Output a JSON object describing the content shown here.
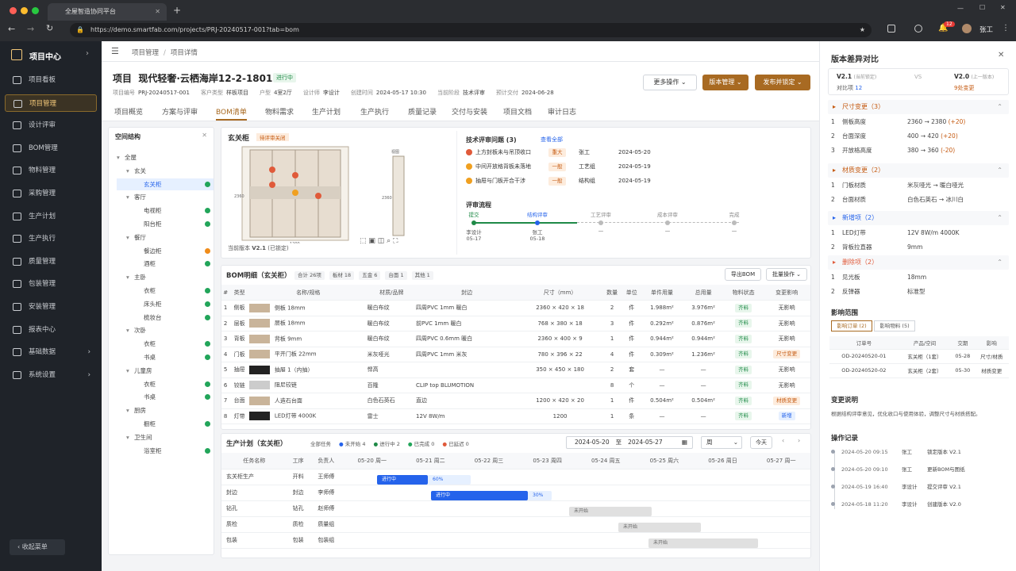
{
  "browser": {
    "tab_title": "全屋智造协同平台",
    "url": "https://demo.smartfab.com/projects/PRJ-20240517-001?tab=bom",
    "user": "张工",
    "notif": "12"
  },
  "sidebar": {
    "title": "项目中心",
    "items": [
      "项目看板",
      "项目管理",
      "设计评审",
      "BOM管理",
      "物料管理",
      "采购管理",
      "生产计划",
      "生产执行",
      "质量管理",
      "包装管理",
      "安装管理",
      "报表中心",
      "基础数据",
      "系统设置"
    ],
    "collapse": "收起菜单"
  },
  "breadcrumb": [
    "项目管理",
    "项目详情"
  ],
  "project": {
    "prefix": "项目",
    "name": "现代轻奢·云栖海岸12-2-1801",
    "status": "进行中",
    "meta": [
      "项目编号",
      "PRJ-20240517-001",
      "客户类型",
      "样板项目",
      "户型",
      "4室2厅",
      "设计师",
      "李设计",
      "创建时间",
      "2024-05-17 10:30",
      "当前阶段",
      "技术评审",
      "预计交付",
      "2024-06-28"
    ]
  },
  "actions": {
    "more": "更多操作",
    "version": "版本管理",
    "publish": "发布并锁定"
  },
  "tabs": [
    "项目概览",
    "方案与评审",
    "BOM清单",
    "物料需求",
    "生产计划",
    "生产执行",
    "质量记录",
    "交付与安装",
    "项目文档",
    "审计日志"
  ],
  "space": {
    "title": "空间结构",
    "tree": [
      "全屋",
      "玄关",
      "玄关柜",
      "客厅",
      "电视柜",
      "阳台柜",
      "餐厅",
      "餐边柜",
      "酒柜",
      "主卧",
      "衣柜",
      "床头柜",
      "梳妆台",
      "次卧",
      "衣柜",
      "书桌",
      "儿童房",
      "衣柜",
      "书桌",
      "厨房",
      "橱柜",
      "卫生间",
      "浴室柜"
    ]
  },
  "preview": {
    "title": "玄关柜",
    "badge": "待评审关闭",
    "version_label": "当前版本",
    "version": "V2.1",
    "locked": "(已锁定)",
    "dims": [
      "2360",
      "1200",
      "2360",
      "350",
      "400",
      "600",
      "视图"
    ]
  },
  "issues": {
    "title": "技术评审问题",
    "count": "(3)",
    "view_all": "查看全部",
    "items": [
      [
        "上方封板未与吊顶收口",
        "重大",
        "张工",
        "2024-05-20"
      ],
      [
        "中间开放格背板未落地",
        "一般",
        "工艺组",
        "2024-05-19"
      ],
      [
        "抽屉与门板开合干涉",
        "一般",
        "结构组",
        "2024-05-19"
      ]
    ]
  },
  "flow": {
    "title": "评审流程",
    "steps": [
      [
        "提交",
        "李设计",
        "05-17"
      ],
      [
        "结构评审",
        "张工",
        "05-18"
      ],
      [
        "工艺评审",
        "—",
        ""
      ],
      [
        "成本评审",
        "—",
        ""
      ],
      [
        "完成",
        "—",
        ""
      ]
    ]
  },
  "bom": {
    "title": "BOM明细（玄关柜）",
    "stats": [
      "合计 26项",
      "板材 18",
      "五金 6",
      "台面 1",
      "其他 1"
    ],
    "export": "导出BOM",
    "batch": "批量操作",
    "headers": [
      "#",
      "类型",
      "名称/规格",
      "材质/品牌",
      "封边",
      "尺寸（mm）",
      "数量",
      "单位",
      "单件用量",
      "总用量",
      "物料状态",
      "变更影响"
    ],
    "rows": [
      [
        "1",
        "侧板",
        "侧板 18mm",
        "暖白布纹",
        "四周PVC 1mm 暖白",
        "2360 × 420 × 18",
        "2",
        "件",
        "1.988m²",
        "3.976m²",
        "齐料",
        "无影响"
      ],
      [
        "2",
        "层板",
        "层板 18mm",
        "暖白布纹",
        "前PVC 1mm 暖白",
        "768 × 380 × 18",
        "3",
        "件",
        "0.292m²",
        "0.876m²",
        "齐料",
        "无影响"
      ],
      [
        "3",
        "背板",
        "背板 9mm",
        "暖白布纹",
        "四周PVC 0.6mm 暖白",
        "2360 × 400 × 9",
        "1",
        "件",
        "0.944m²",
        "0.944m²",
        "齐料",
        "无影响"
      ],
      [
        "4",
        "门板",
        "平开门板 22mm",
        "米灰哑光",
        "四周PVC 1mm 米灰",
        "780 × 396 × 22",
        "4",
        "件",
        "0.309m²",
        "1.236m²",
        "齐料",
        "尺寸变更"
      ],
      [
        "5",
        "抽屉",
        "抽屉 1（内抽）",
        "悍高",
        "",
        "350 × 450 × 180",
        "2",
        "套",
        "—",
        "—",
        "齐料",
        "无影响"
      ],
      [
        "6",
        "铰链",
        "阻尼铰链",
        "百隆",
        "CLIP top BLUMOTION",
        "",
        "8",
        "个",
        "—",
        "—",
        "齐料",
        "无影响"
      ],
      [
        "7",
        "台面",
        "人造石台面",
        "白色石英石",
        "直边",
        "1200 × 420 × 20",
        "1",
        "件",
        "0.504m²",
        "0.504m²",
        "齐料",
        "材质变更"
      ],
      [
        "8",
        "灯带",
        "LED灯带 4000K",
        "雷士",
        "12V 8W/m",
        "1200",
        "1",
        "条",
        "—",
        "—",
        "齐料",
        "新增"
      ]
    ]
  },
  "plan": {
    "title": "生产计划（玄关柜）",
    "legend": [
      "全部任务",
      "未开始 4",
      "进行中 2",
      "已完成 0",
      "已延迟 0"
    ],
    "from": "2024-05-20",
    "to": "2024-05-27",
    "sep": "至",
    "unit": "周",
    "today": "今天",
    "headers": [
      "任务名称",
      "工序",
      "负责人",
      "05-20 周一",
      "05-21 周二",
      "05-22 周三",
      "05-23 周四",
      "05-24 周五",
      "05-25 周六",
      "05-26 周日",
      "05-27 周一"
    ],
    "rows": [
      [
        "玄关柜生产",
        "开料",
        "王师傅",
        "进行中",
        "60%"
      ],
      [
        "封边",
        "封边",
        "李师傅",
        "进行中",
        "30%"
      ],
      [
        "钻孔",
        "钻孔",
        "赵师傅",
        "未开始",
        ""
      ],
      [
        "质检",
        "质检",
        "质量组",
        "未开始",
        ""
      ],
      [
        "包装",
        "包装",
        "包装组",
        "未开始",
        ""
      ]
    ]
  },
  "diff": {
    "title": "版本差异对比",
    "v1": "V2.1",
    "v1n": "(当前锁定)",
    "vs": "VS",
    "v2": "V2.0",
    "v2n": "(上一版本)",
    "cmp": "对比项",
    "cmp_n": "12",
    "diff_n": "9处变更",
    "size": {
      "title": "尺寸变更（3）",
      "rows": [
        [
          "1",
          "侧板高度",
          "2360 → 2380",
          "(+20)"
        ],
        [
          "2",
          "台面深度",
          "400 → 420",
          "(+20)"
        ],
        [
          "3",
          "开放格高度",
          "380 → 360",
          "(-20)"
        ]
      ]
    },
    "mat": {
      "title": "材质变更（2）",
      "rows": [
        [
          "1",
          "门板材质",
          "米灰哑光 → 暖白哑光"
        ],
        [
          "2",
          "台面材质",
          "白色石英石 → 冰川白"
        ]
      ]
    },
    "add": {
      "title": "新增项（2）",
      "rows": [
        [
          "1",
          "LED灯带",
          "12V 8W/m 4000K"
        ],
        [
          "2",
          "背板拉直器",
          "9mm"
        ]
      ]
    },
    "del": {
      "title": "删除项（2）",
      "rows": [
        [
          "1",
          "见光板",
          "18mm"
        ],
        [
          "2",
          "反弹器",
          "标准型"
        ]
      ]
    },
    "impact": {
      "title": "影响范围",
      "tabs": [
        "影响订单 (2)",
        "影响物料 (5)"
      ],
      "headers": [
        "订单号",
        "产品/空间",
        "交期",
        "影响"
      ],
      "rows": [
        [
          "OD-20240520-01",
          "玄关柜（1套）",
          "05-28",
          "尺寸/材质"
        ],
        [
          "OD-20240520-02",
          "玄关柜（2套）",
          "05-30",
          "材质变更"
        ]
      ]
    },
    "note_title": "变更说明",
    "note": "根据结构评审意见，优化收口与使用体验，调整尺寸与材质搭配。",
    "log_title": "操作记录",
    "log": [
      [
        "2024-05-20 09:15",
        "张工",
        "锁定版本 V2.1"
      ],
      [
        "2024-05-20 09:10",
        "张工",
        "更新BOM与图纸"
      ],
      [
        "2024-05-19 16:40",
        "李设计",
        "提交评审 V2.1"
      ],
      [
        "2024-05-18 11:20",
        "李设计",
        "创建版本 V2.0"
      ]
    ]
  },
  "colors": {
    "accent": "#a86a22",
    "blue": "#2563eb",
    "green": "#22a55a"
  }
}
